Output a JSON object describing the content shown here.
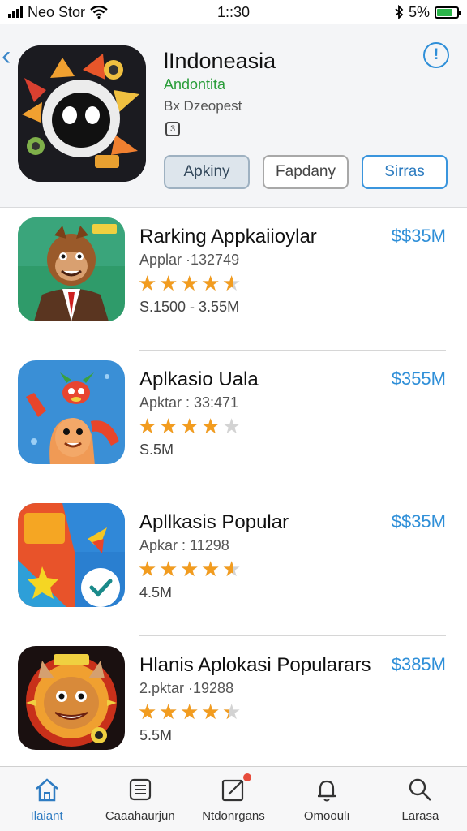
{
  "status_bar": {
    "carrier": "Neo Stor",
    "time": "1::30",
    "battery_percent": "5%",
    "battery_level": 0.8
  },
  "header": {
    "app_name": "lIndoneasia",
    "developer": "Andontita",
    "subtitle": "Bx Dzeopest",
    "buttons": {
      "primary": "Apkiny",
      "secondary": "Fapdany",
      "accent": "Sirras"
    }
  },
  "apps": [
    {
      "title": "Rarking Appkaiioylar",
      "price": "$$35M",
      "meta": "Applar ·132749",
      "rating": 4.5,
      "size": "S.1500 - 3.55M"
    },
    {
      "title": "Aplkasio Uala",
      "price": "$355M",
      "meta": "Apktar : 33:471",
      "rating": 4.0,
      "size": "S.5M"
    },
    {
      "title": "Apllkasis Popular",
      "price": "$$35M",
      "meta": "Apkar : 11298",
      "rating": 4.5,
      "size": "4.5M"
    },
    {
      "title": "Hlanis Aplokasi Popularars",
      "price": "$385M",
      "meta": "2.pktar ·19288",
      "rating": 4.3,
      "size": "5.5M"
    }
  ],
  "tabs": [
    {
      "label": "Ilaiant",
      "icon": "home-icon"
    },
    {
      "label": "Caaahaurjun",
      "icon": "news-icon"
    },
    {
      "label": "Ntdonrgans",
      "icon": "edit-icon"
    },
    {
      "label": "Omooulı",
      "icon": "bell-icon"
    },
    {
      "label": "Larasa",
      "icon": "search-icon"
    }
  ],
  "colors": {
    "accent": "#2f8fd8",
    "star": "#f29c1f",
    "developer": "#2a9d3a",
    "battery": "#2bb44a",
    "notification": "#e74c3c"
  }
}
